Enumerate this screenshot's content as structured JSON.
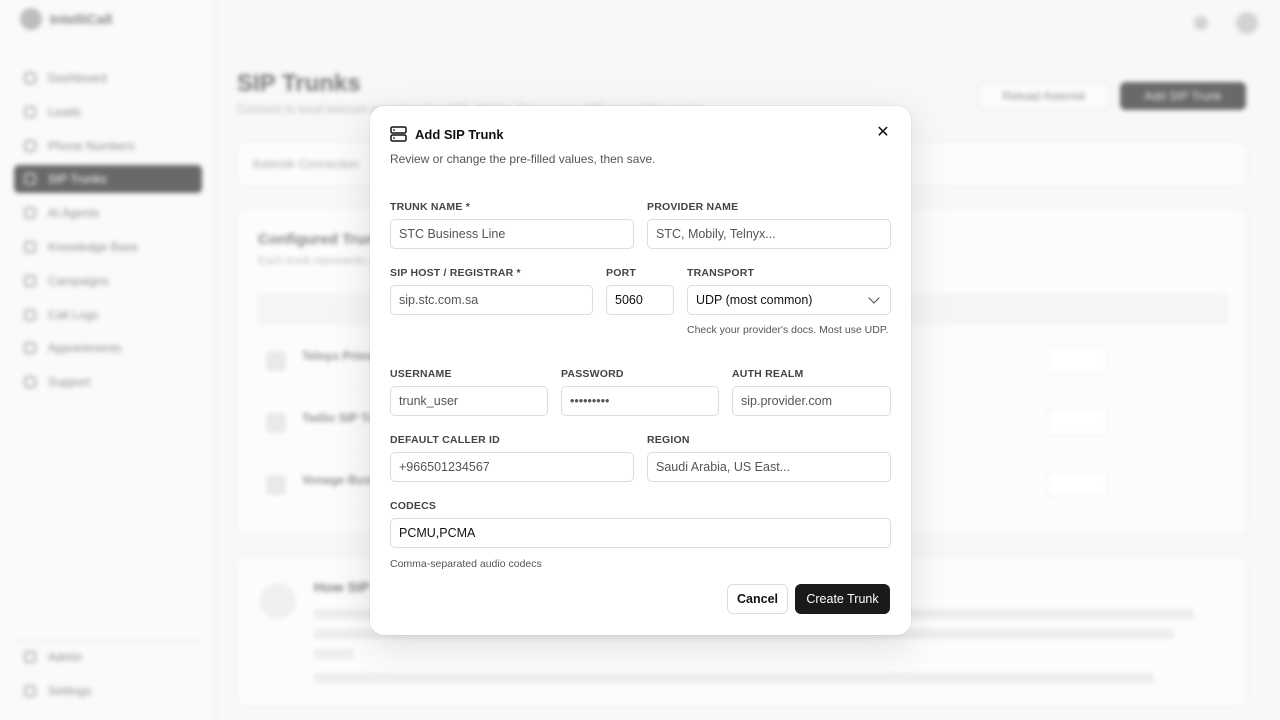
{
  "background": {
    "brand": "IntelliCall",
    "nav": [
      "Dashboard",
      "Leads",
      "Phone Numbers",
      "SIP Trunks",
      "AI Agents",
      "Knowledge Base",
      "Campaigns",
      "Call Logs",
      "Appointments",
      "Support"
    ],
    "nav_active": "SIP Trunks",
    "nav_bottom": [
      "Admin",
      "Settings"
    ],
    "page_title": "SIP Trunks",
    "page_subtitle": "Connect to local telecom providers like STC, Mobily, Zain, or any SIP-compatible carrier",
    "reload_button": "Reload Asterisk",
    "add_button": "Add SIP Trunk",
    "connection_bar": "Asterisk Connection",
    "configured_title": "Configured Trunks",
    "configured_subtitle": "Each trunk represents a connection to a SIP provider",
    "rows": [
      "Telnyx Primary",
      "Twilio SIP Trunk",
      "Vonage Business"
    ],
    "row_test_label": "Test",
    "help_title": "How SIP Trunks Work"
  },
  "modal": {
    "title": "Add SIP Trunk",
    "description": "Review or change the pre-filled values, then save.",
    "close_icon": "close-icon",
    "fields": {
      "trunk_name": {
        "label": "TRUNK NAME *",
        "placeholder": "STC Business Line",
        "value": ""
      },
      "provider_name": {
        "label": "PROVIDER NAME",
        "placeholder": "STC, Mobily, Telnyx...",
        "value": ""
      },
      "sip_host": {
        "label": "SIP HOST / REGISTRAR *",
        "placeholder": "sip.stc.com.sa",
        "value": ""
      },
      "port": {
        "label": "PORT",
        "placeholder": "",
        "value": "5060"
      },
      "transport": {
        "label": "TRANSPORT",
        "value": "UDP (most common)",
        "hint": "Check your provider's docs. Most use UDP."
      },
      "username": {
        "label": "USERNAME",
        "placeholder": "trunk_user",
        "value": ""
      },
      "password": {
        "label": "PASSWORD",
        "placeholder": "•••••••••",
        "value": ""
      },
      "auth_realm": {
        "label": "AUTH REALM",
        "placeholder": "sip.provider.com",
        "value": ""
      },
      "caller_id": {
        "label": "DEFAULT CALLER ID",
        "placeholder": "+966501234567",
        "value": ""
      },
      "region": {
        "label": "REGION",
        "placeholder": "Saudi Arabia, US East...",
        "value": ""
      },
      "codecs": {
        "label": "CODECS",
        "placeholder": "",
        "value": "PCMU,PCMA",
        "hint": "Comma-separated audio codecs"
      }
    },
    "cancel_label": "Cancel",
    "create_label": "Create Trunk"
  }
}
